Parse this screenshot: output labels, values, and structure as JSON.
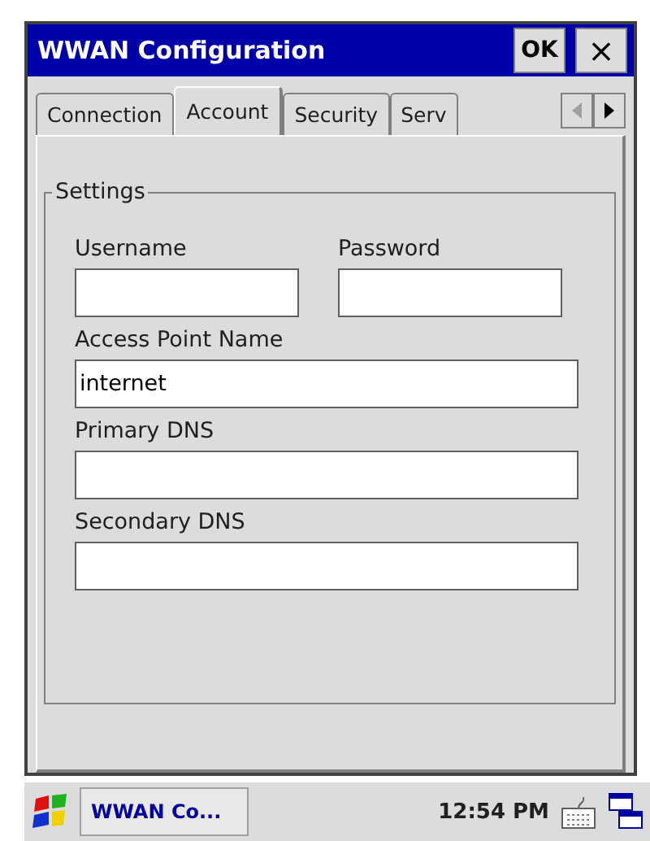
{
  "window": {
    "title": "WWAN Configuration",
    "buttons": [
      {
        "kind": "ok",
        "label": "OK"
      },
      {
        "kind": "close",
        "label": "×"
      }
    ]
  },
  "tabs": [
    {
      "label": "Connection",
      "selected": false
    },
    {
      "label": "Account",
      "selected": true
    },
    {
      "label": "Security",
      "selected": false
    },
    {
      "label": "Serv",
      "selected": false
    }
  ],
  "tab_scroll": {
    "left": {
      "disabled": true
    },
    "right": {
      "disabled": false
    }
  },
  "group": {
    "title": "Settings",
    "fields": [
      {
        "label": "Username",
        "kind": "short"
      },
      {
        "label": "Password",
        "kind": "short"
      },
      {
        "label": "Access Point Name",
        "value": "internet",
        "kind": "long"
      },
      {
        "label": "Primary DNS",
        "kind": "long"
      },
      {
        "label": "Secondary DNS",
        "kind": "long"
      }
    ]
  },
  "taskbar": {
    "task": "WWAN Co...",
    "time": "12:54 PM"
  }
}
